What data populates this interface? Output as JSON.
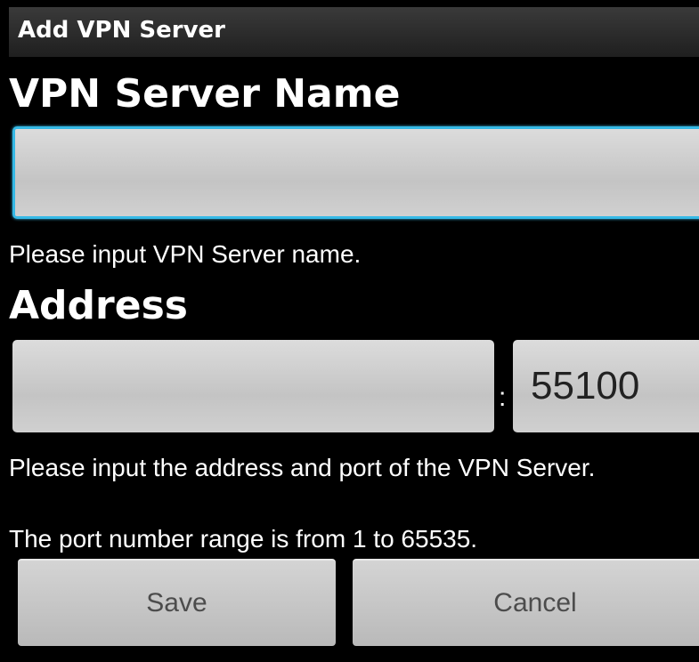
{
  "dialog": {
    "title": "Add VPN Server"
  },
  "server_name": {
    "label": "VPN Server Name",
    "value": "",
    "hint": "Please input VPN Server name."
  },
  "address": {
    "label": "Address",
    "value": "",
    "separator": ":",
    "port_value": "55100",
    "hint_line1": "Please input the address and port of the VPN Server.",
    "hint_line2": "The port number range is from 1 to 65535."
  },
  "buttons": {
    "save_label": "Save",
    "cancel_label": "Cancel"
  },
  "colors": {
    "focus_accent": "#35b9e6",
    "background": "#000000",
    "text": "#ffffff"
  }
}
